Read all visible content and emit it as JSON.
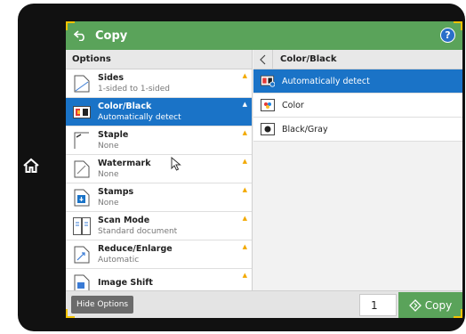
{
  "titlebar": {
    "title": "Copy",
    "help_label": "?"
  },
  "options_header": "Options",
  "options": [
    {
      "label": "Sides",
      "value": "1-sided to 1-sided",
      "icon": "sides-icon"
    },
    {
      "label": "Color/Black",
      "value": "Automatically detect",
      "icon": "color-black-icon"
    },
    {
      "label": "Staple",
      "value": "None",
      "icon": "staple-icon"
    },
    {
      "label": "Watermark",
      "value": "None",
      "icon": "watermark-icon"
    },
    {
      "label": "Stamps",
      "value": "None",
      "icon": "stamps-icon"
    },
    {
      "label": "Scan Mode",
      "value": "Standard document",
      "icon": "scan-mode-icon"
    },
    {
      "label": "Reduce/Enlarge",
      "value": "Automatic",
      "icon": "reduce-enlarge-icon"
    },
    {
      "label": "Image Shift",
      "value": "",
      "icon": "image-shift-icon"
    }
  ],
  "detail": {
    "title": "Color/Black",
    "choices": [
      {
        "label": "Automatically detect",
        "icon": "auto-detect-icon"
      },
      {
        "label": "Color",
        "icon": "color-icon"
      },
      {
        "label": "Black/Gray",
        "icon": "black-gray-icon"
      }
    ]
  },
  "bottombar": {
    "hide_label": "Hide Options",
    "copies": "1",
    "copy_label": "Copy"
  },
  "colors": {
    "green": "#5aa35a",
    "blue": "#1a73c7",
    "accent": "#f2c300"
  }
}
